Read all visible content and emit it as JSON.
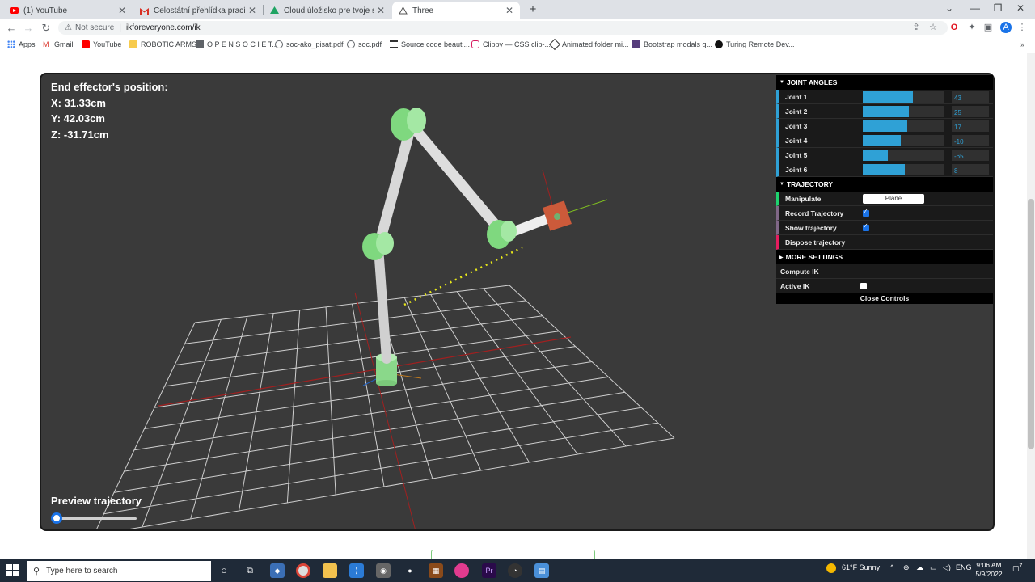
{
  "browser": {
    "tabs": [
      {
        "title": "(1) YouTube",
        "icon": "youtube-icon",
        "active": false
      },
      {
        "title": "Celostátní přehlídka prací SOČ v",
        "icon": "gmail-icon",
        "active": false
      },
      {
        "title": "Cloud úložisko pre tvoje súbory",
        "icon": "drive-icon",
        "active": false
      },
      {
        "title": "Three",
        "icon": "three-icon",
        "active": true
      }
    ],
    "new_tab": "+",
    "security_label": "Not secure",
    "url": "ikforeveryone.com/ik",
    "bookmarks": [
      "Apps",
      "Gmail",
      "YouTube",
      "ROBOTIC ARMS",
      "O P E N S O C I E T...",
      "soc-ako_pisat.pdf",
      "soc.pdf",
      "Source code beauti...",
      "Clippy — CSS clip-...",
      "Animated folder mi...",
      "Bootstrap modals g...",
      "Turing Remote Dev..."
    ]
  },
  "viewer": {
    "end_effector_title": "End effector's position:",
    "x": "X: 31.33cm",
    "y": "Y: 42.03cm",
    "z": "Z: -31.71cm",
    "preview_label": "Preview trajectory",
    "preview_progress": 0
  },
  "gui": {
    "joint_angles_title": "JOINT ANGLES",
    "joints": [
      {
        "label": "Joint 1",
        "value": "43",
        "fill": 0.62
      },
      {
        "label": "Joint 2",
        "value": "25",
        "fill": 0.57
      },
      {
        "label": "Joint 3",
        "value": "17",
        "fill": 0.55
      },
      {
        "label": "Joint 4",
        "value": "-10",
        "fill": 0.47
      },
      {
        "label": "Joint 5",
        "value": "-65",
        "fill": 0.31
      },
      {
        "label": "Joint 6",
        "value": "8",
        "fill": 0.52
      }
    ],
    "trajectory_title": "TRAJECTORY",
    "manipulate_label": "Manipulate",
    "manipulate_value": "Plane",
    "record_label": "Record Trajectory",
    "record_checked": true,
    "show_label": "Show trajectory",
    "show_checked": true,
    "dispose_label": "Dispose trajectory",
    "more_title": "MORE SETTINGS",
    "compute_label": "Compute IK",
    "active_label": "Active IK",
    "active_checked": false,
    "close_label": "Close Controls"
  },
  "taskbar": {
    "search_placeholder": "Type here to search",
    "weather": "61°F  Sunny",
    "language": "ENG",
    "time": "9:06 AM",
    "date": "5/9/2022",
    "notification_count": "7"
  }
}
